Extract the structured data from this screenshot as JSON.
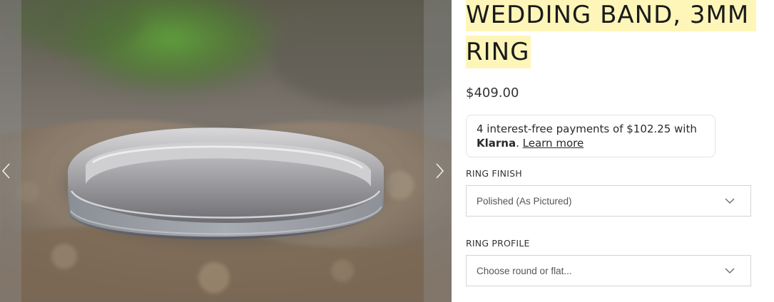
{
  "product": {
    "title_line1": "WEDDING BAND, 3MM",
    "title_line2": "RING",
    "price": "$409.00"
  },
  "klarna": {
    "text": "4 interest-free payments of $102.25 with",
    "brand": "Klarna",
    "link": "Learn more"
  },
  "options": {
    "finish": {
      "label": "RING FINISH",
      "value": "Polished (As Pictured)"
    },
    "profile": {
      "label": "RING PROFILE",
      "placeholder": "Choose round or flat..."
    }
  },
  "gallery": {
    "prev_icon": "chevron-left-icon",
    "next_icon": "chevron-right-icon"
  },
  "colors": {
    "title_highlight": "#fdf6b8",
    "border": "#d4d4d4"
  }
}
